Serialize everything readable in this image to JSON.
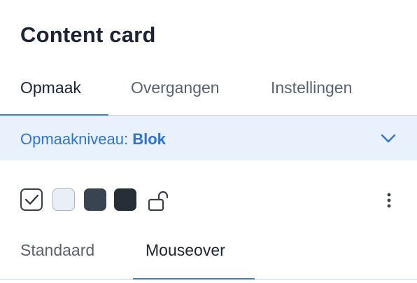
{
  "panel": {
    "title": "Content card"
  },
  "tabs": [
    {
      "label": "Opmaak",
      "active": true
    },
    {
      "label": "Overgangen",
      "active": false
    },
    {
      "label": "Instellingen",
      "active": false
    }
  ],
  "level": {
    "label": "Opmaakniveau:",
    "value": "Blok",
    "icon": "chevron-down-icon"
  },
  "swatches": [
    {
      "name": "selected",
      "color": "#ffffff",
      "checked": true
    },
    {
      "name": "light",
      "color": "#e9eef7"
    },
    {
      "name": "medium-dark",
      "color": "#3a4350"
    },
    {
      "name": "dark",
      "color": "#262e38"
    }
  ],
  "icons": {
    "lock": "lock-open-icon",
    "more": "kebab-menu-icon"
  },
  "subtabs": [
    {
      "label": "Standaard",
      "active": false
    },
    {
      "label": "Mouseover",
      "active": true
    }
  ],
  "colors": {
    "accent": "#3b7ddd",
    "level_bg": "#e8f1fc"
  }
}
